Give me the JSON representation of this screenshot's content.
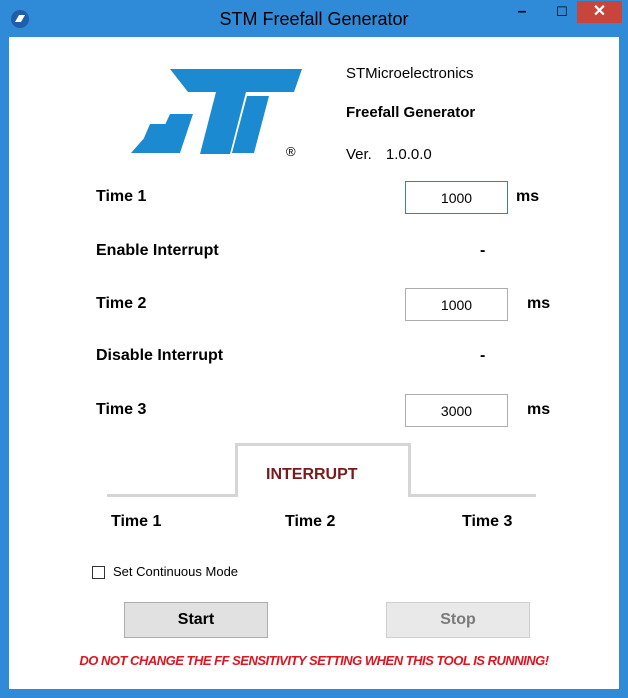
{
  "window": {
    "title": "STM Freefall Generator",
    "minimize_glyph": "–",
    "maximize_glyph": "☐",
    "close_glyph": "✕",
    "accent_color": "#2f8ad8",
    "close_color": "#c7453b"
  },
  "header": {
    "logo_icon": "st-logo-icon",
    "logo_registered": "®",
    "company": "STMicroelectronics",
    "product": "Freefall Generator",
    "version_label": "Ver.",
    "version_value": "1.0.0.0"
  },
  "form": {
    "time1_label": "Time 1",
    "time1_value": "1000",
    "time1_unit": "ms",
    "enable_interrupt_label": "Enable Interrupt",
    "enable_interrupt_value": "-",
    "time2_label": "Time 2",
    "time2_value": "1000",
    "time2_unit": "ms",
    "disable_interrupt_label": "Disable Interrupt",
    "disable_interrupt_value": "-",
    "time3_label": "Time 3",
    "time3_value": "3000",
    "time3_unit": "ms"
  },
  "diagram": {
    "interrupt_label": "INTERRUPT",
    "time1": "Time 1",
    "time2": "Time 2",
    "time3": "Time 3",
    "interrupt_color": "#7b1a1a"
  },
  "options": {
    "continuous_mode_label": "Set Continuous Mode",
    "continuous_mode_checked": false
  },
  "actions": {
    "start_label": "Start",
    "stop_label": "Stop"
  },
  "warning": {
    "text": "DO NOT CHANGE THE FF SENSITIVITY SETTING WHEN THIS TOOL IS RUNNING!",
    "color": "#e0141f"
  }
}
